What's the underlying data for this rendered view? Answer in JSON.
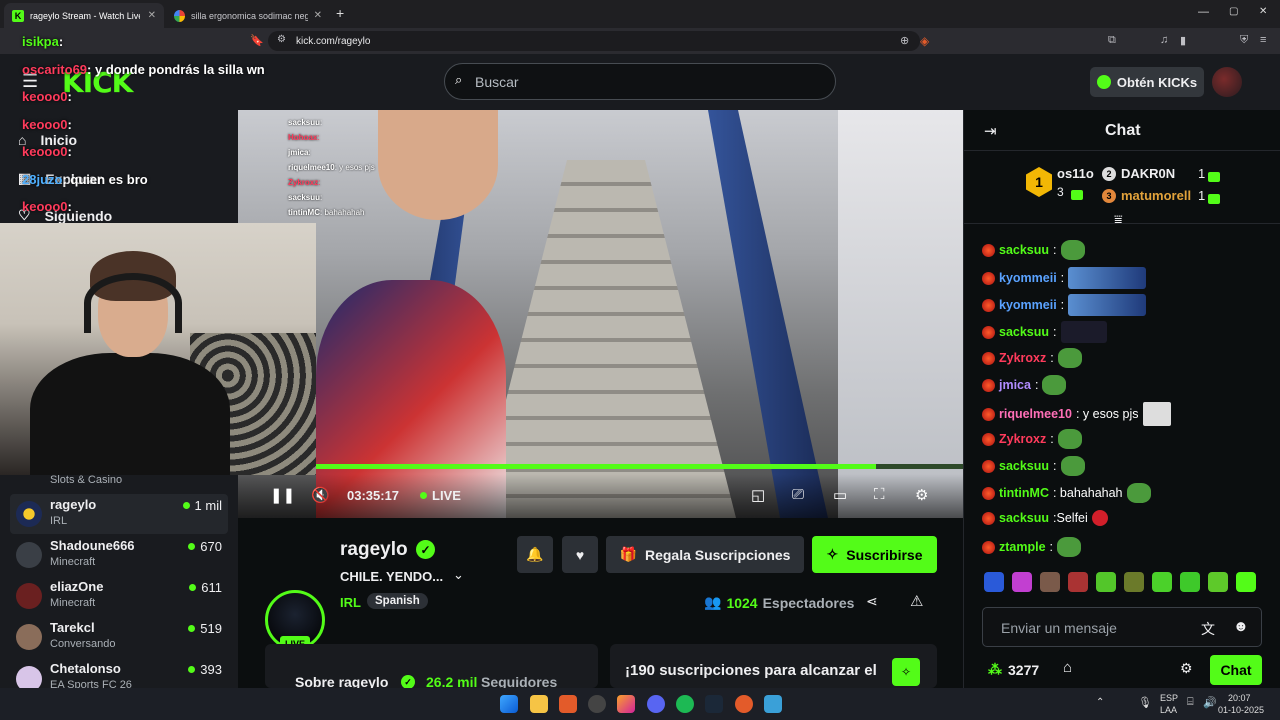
{
  "browser": {
    "tabs": [
      {
        "title": "rageylo Stream - Watch Live on",
        "active": true
      },
      {
        "title": "silla ergonomica sodimac negras - G",
        "active": false
      }
    ],
    "new_tab": "+",
    "url": "kick.com/rageylo",
    "window_controls": [
      "—",
      "▢",
      "✕"
    ]
  },
  "site": {
    "logo": "KICK",
    "search_placeholder": "Buscar",
    "get_kicks": "Obtén KICKs",
    "nav": [
      {
        "label": "Inicio",
        "icon": "home-icon"
      },
      {
        "label": "Explorar",
        "icon": "browse-icon"
      },
      {
        "label": "Siguiendo",
        "icon": "heart-icon"
      }
    ],
    "sidebar_channels": [
      {
        "name": "",
        "category": "Slots & Casino",
        "viewers": ""
      },
      {
        "name": "rageylo",
        "category": "IRL",
        "viewers": "1 mil"
      },
      {
        "name": "Shadoune666",
        "category": "Minecraft",
        "viewers": "670"
      },
      {
        "name": "eliazOne",
        "category": "Minecraft",
        "viewers": "611"
      },
      {
        "name": "Tarekcl",
        "category": "Conversando",
        "viewers": "519"
      },
      {
        "name": "Chetalonso",
        "category": "EA Sports FC 26",
        "viewers": "393"
      }
    ],
    "overlay_chat": [
      {
        "user": "isikpa",
        "text": ":"
      },
      {
        "user": "oscarito69",
        "text": ": y donde pondrás la silla wn"
      },
      {
        "user": "keooo0",
        "text": ":"
      },
      {
        "user": "keooo0",
        "text": ":"
      },
      {
        "user": "keooo0",
        "text": ":"
      },
      {
        "user": "28juzo",
        "text": ": quien es bro"
      },
      {
        "user": "keooo0",
        "text": ":"
      }
    ],
    "video_overlay_chat": [
      {
        "user": "sacksuu",
        "text": ":"
      },
      {
        "user": "Hohoax",
        "text": ":"
      },
      {
        "user": "jmica",
        "text": ":"
      },
      {
        "user": "riquelmee10",
        "text": ": y esos pjs"
      },
      {
        "user": "Zykroxz",
        "text": ":"
      },
      {
        "user": "sacksuu",
        "text": ":"
      },
      {
        "user": "tintinMC",
        "text": ": bahahahah"
      }
    ]
  },
  "player": {
    "timecode": "03:35:17",
    "live": "LIVE",
    "progress": 0.88
  },
  "channel": {
    "name": "rageylo",
    "title": "CHILE. YENDO...",
    "category": "IRL",
    "language": "Spanish",
    "live_badge": "LIVE",
    "gift_button": "Regala Suscripciones",
    "subscribe_button": "Suscribirse",
    "viewers": "1024",
    "viewers_label": "Espectadores",
    "about": "Sobre rageylo",
    "followers": "26.2 mil",
    "followers_label": "Seguidores",
    "sub_goal": "¡190 suscripciones para alcanzar el"
  },
  "chat": {
    "title": "Chat",
    "leaderboard": [
      {
        "rank": "1",
        "name": "os11o",
        "count": "3"
      },
      {
        "rank": "2",
        "name": "DAKR0N",
        "count": "1"
      },
      {
        "rank": "3",
        "name": "matumorell",
        "count": "1"
      }
    ],
    "messages": [
      {
        "user": "sacksuu",
        "color": "#53fc18",
        "text": ":",
        "emote": "pepe"
      },
      {
        "user": "kyommeii",
        "color": "#5aa2ff",
        "text": ":",
        "emote": "wide"
      },
      {
        "user": "kyommeii",
        "color": "#5aa2ff",
        "text": ":",
        "emote": "wide"
      },
      {
        "user": "sacksuu",
        "color": "#53fc18",
        "text": ":",
        "emote": "dark"
      },
      {
        "user": "Zykroxz",
        "color": "#ff3b5c",
        "text": ":",
        "emote": "pepe"
      },
      {
        "user": "jmica",
        "color": "#b18cff",
        "text": ":",
        "emote": "pepe"
      },
      {
        "user": "riquelmee10",
        "color": "#ff6fb7",
        "text": ": y esos pjs",
        "emote": "sq"
      },
      {
        "user": "Zykroxz",
        "color": "#ff3b5c",
        "text": ":",
        "emote": "pepe"
      },
      {
        "user": "sacksuu",
        "color": "#53fc18",
        "text": ":",
        "emote": "pepe"
      },
      {
        "user": "tintinMC",
        "color": "#53fc18",
        "text": ": bahahahah",
        "emote": "pepe"
      },
      {
        "user": "sacksuu",
        "color": "#53fc18",
        "text": ":Selfei",
        "emote": "red"
      },
      {
        "user": "ztample",
        "color": "#53fc18",
        "text": ":",
        "emote": "pepe"
      }
    ],
    "input_placeholder": "Enviar un mensaje",
    "points": "3277",
    "send_button": "Chat"
  },
  "taskbar": {
    "lang": "ESP",
    "lang_sub": "LAA",
    "time": "20:07",
    "date": "01-10-2025"
  },
  "colors": {
    "accent": "#53fc18",
    "bg": "#0b0e0f",
    "panel": "#191b1f"
  }
}
